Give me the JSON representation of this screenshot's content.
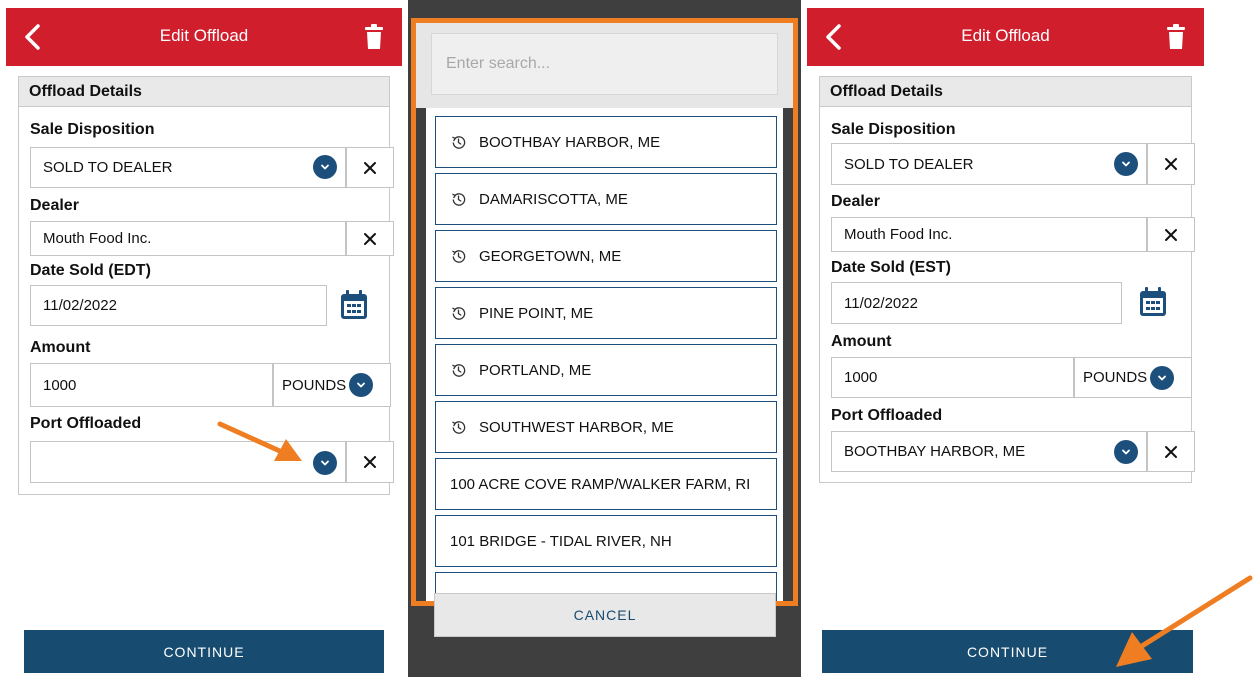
{
  "left_screen": {
    "header": {
      "title": "Edit Offload"
    },
    "section_title": "Offload Details",
    "sale_disposition": {
      "label": "Sale Disposition",
      "value": "SOLD TO DEALER"
    },
    "dealer": {
      "label": "Dealer",
      "value": "Mouth Food Inc."
    },
    "date_sold": {
      "label": "Date Sold (EDT)",
      "value": "11/02/2022"
    },
    "amount": {
      "label": "Amount",
      "value": "1000",
      "unit": "POUNDS"
    },
    "port_offloaded": {
      "label": "Port Offloaded",
      "value": ""
    },
    "continue_label": "CONTINUE"
  },
  "picker": {
    "search_placeholder": "Enter search...",
    "items": [
      {
        "label": "BOOTHBAY HARBOR, ME",
        "recent": true
      },
      {
        "label": "DAMARISCOTTA, ME",
        "recent": true
      },
      {
        "label": "GEORGETOWN, ME",
        "recent": true
      },
      {
        "label": "PINE POINT, ME",
        "recent": true
      },
      {
        "label": "PORTLAND, ME",
        "recent": true
      },
      {
        "label": "SOUTHWEST HARBOR, ME",
        "recent": true
      },
      {
        "label": "100 ACRE COVE RAMP/WALKER FARM, RI",
        "recent": false
      },
      {
        "label": "101 BRIDGE - TIDAL RIVER, NH",
        "recent": false
      },
      {
        "label": "",
        "recent": false
      }
    ],
    "cancel_label": "CANCEL"
  },
  "right_screen": {
    "header": {
      "title": "Edit Offload"
    },
    "section_title": "Offload Details",
    "sale_disposition": {
      "label": "Sale Disposition",
      "value": "SOLD TO DEALER"
    },
    "dealer": {
      "label": "Dealer",
      "value": "Mouth Food Inc."
    },
    "date_sold": {
      "label": "Date Sold (EST)",
      "value": "11/02/2022"
    },
    "amount": {
      "label": "Amount",
      "value": "1000",
      "unit": "POUNDS"
    },
    "port_offloaded": {
      "label": "Port Offloaded",
      "value": "BOOTHBAY HARBOR, ME"
    },
    "continue_label": "CONTINUE"
  },
  "colors": {
    "header_red": "#d01e2c",
    "primary_blue": "#174b6f",
    "highlight_orange": "#ef7d22",
    "picker_backdrop": "#3f3f3f"
  },
  "icons": {
    "back": "chevron-left-icon",
    "delete": "trash-icon",
    "dropdown": "chevron-down-circle-icon",
    "clear": "close-icon",
    "calendar": "calendar-icon",
    "recent": "history-icon",
    "annotation": "arrow-icon"
  }
}
